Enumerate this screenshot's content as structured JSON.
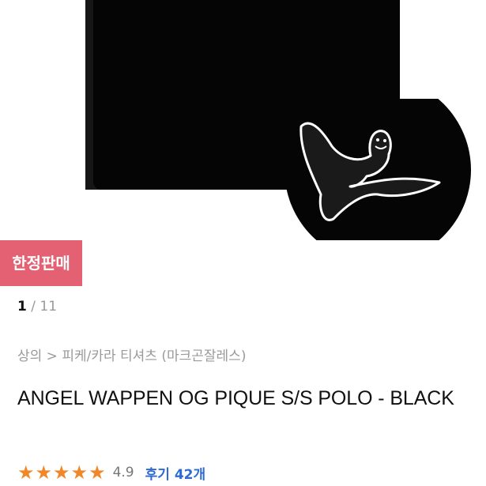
{
  "product": {
    "badge": "한정판매",
    "pager": {
      "current": "1",
      "separator": " / ",
      "total": "11"
    },
    "breadcrumb": "상의 > 피케/카라 티셔츠 (마크곤잘레스)",
    "title": "ANGEL WAPPEN OG PIQUE S/S POLO - BLACK",
    "rating": {
      "stars": "★★★★★",
      "score": "4.9",
      "reviews_label": "후기 42개"
    }
  },
  "colors": {
    "badge": "#e46073",
    "stars": "#f0882a",
    "reviews": "#2f6ad4",
    "shirt": "#050505"
  },
  "icons": {
    "zoom_detail": "angel-logo-icon",
    "star": "star-icon"
  }
}
